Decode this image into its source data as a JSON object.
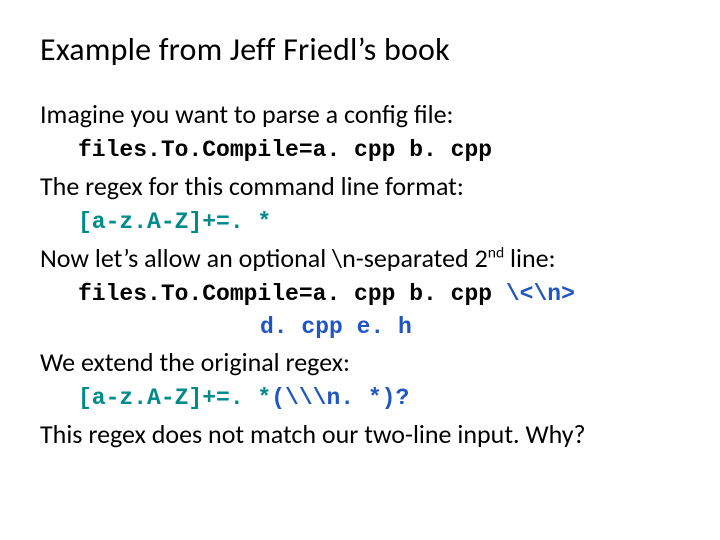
{
  "title": "Example from Jeff Friedl’s book",
  "p1": "Imagine you want to parse a config file:",
  "code1": "files.To.Compile=a. cpp b. cpp",
  "p2": "The regex for this command line format:",
  "code2": "[a-z.A-Z]+=. *",
  "p3_a": "Now let’s allow an optional \\n-separated 2",
  "p3_sup": "nd",
  "p3_b": " line:",
  "code3a_black": "files.To.Compile=a. cpp b. cpp ",
  "code3a_blue": "\\<\\n>",
  "code3b": "d. cpp e. h",
  "p4": "We extend the original regex:",
  "code4_teal": "[a-z.A-Z]+=. *",
  "code4_blue": "(\\\\\\n. *)?",
  "p5": "This regex does not match our two-line input.  Why?"
}
